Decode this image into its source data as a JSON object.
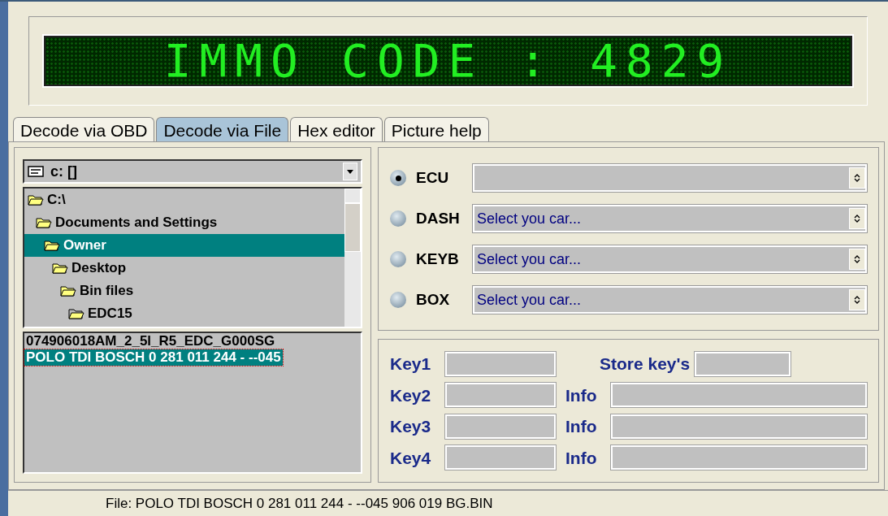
{
  "display": {
    "text": "IMMO CODE : 4829"
  },
  "tabs": [
    {
      "label": "Decode via OBD",
      "selected": false
    },
    {
      "label": "Decode via File",
      "selected": true
    },
    {
      "label": "Hex editor",
      "selected": false
    },
    {
      "label": "Picture help",
      "selected": false
    }
  ],
  "drive_select": {
    "value": "c: []"
  },
  "folder_tree": [
    {
      "label": "C:\\",
      "selected": false,
      "children": [
        {
          "label": "Documents and Settings",
          "selected": false,
          "children": [
            {
              "label": "Owner",
              "selected": true,
              "children": [
                {
                  "label": "Desktop",
                  "selected": false,
                  "children": [
                    {
                      "label": "Bin files",
                      "selected": false,
                      "children": [
                        {
                          "label": "EDC15",
                          "selected": false,
                          "kind": "current"
                        }
                      ]
                    }
                  ]
                }
              ]
            }
          ]
        }
      ]
    }
  ],
  "file_list": [
    {
      "label": "074906018AM_2_5l_R5_EDC_G000SG",
      "selected": false
    },
    {
      "label": "POLO TDI BOSCH 0 281 011 244 - --045",
      "selected": true
    }
  ],
  "modules": [
    {
      "label": "ECU",
      "selected": true
    },
    {
      "label": "DASH",
      "selected": false,
      "value": "Select you car..."
    },
    {
      "label": "KEYB",
      "selected": false,
      "value": "Select you car..."
    },
    {
      "label": "BOX",
      "selected": false,
      "value": "Select you car..."
    }
  ],
  "keys": [
    {
      "label": "Key1",
      "side": {
        "kind": "store",
        "label": "Store key's"
      }
    },
    {
      "label": "Key2",
      "side": {
        "kind": "info",
        "label": "Info"
      }
    },
    {
      "label": "Key3",
      "side": {
        "kind": "info",
        "label": "Info"
      }
    },
    {
      "label": "Key4",
      "side": {
        "kind": "info",
        "label": "Info"
      }
    }
  ],
  "status_bar": {
    "text": "File: POLO TDI BOSCH 0 281 011 244 - --045 906 019 BG.BIN"
  }
}
